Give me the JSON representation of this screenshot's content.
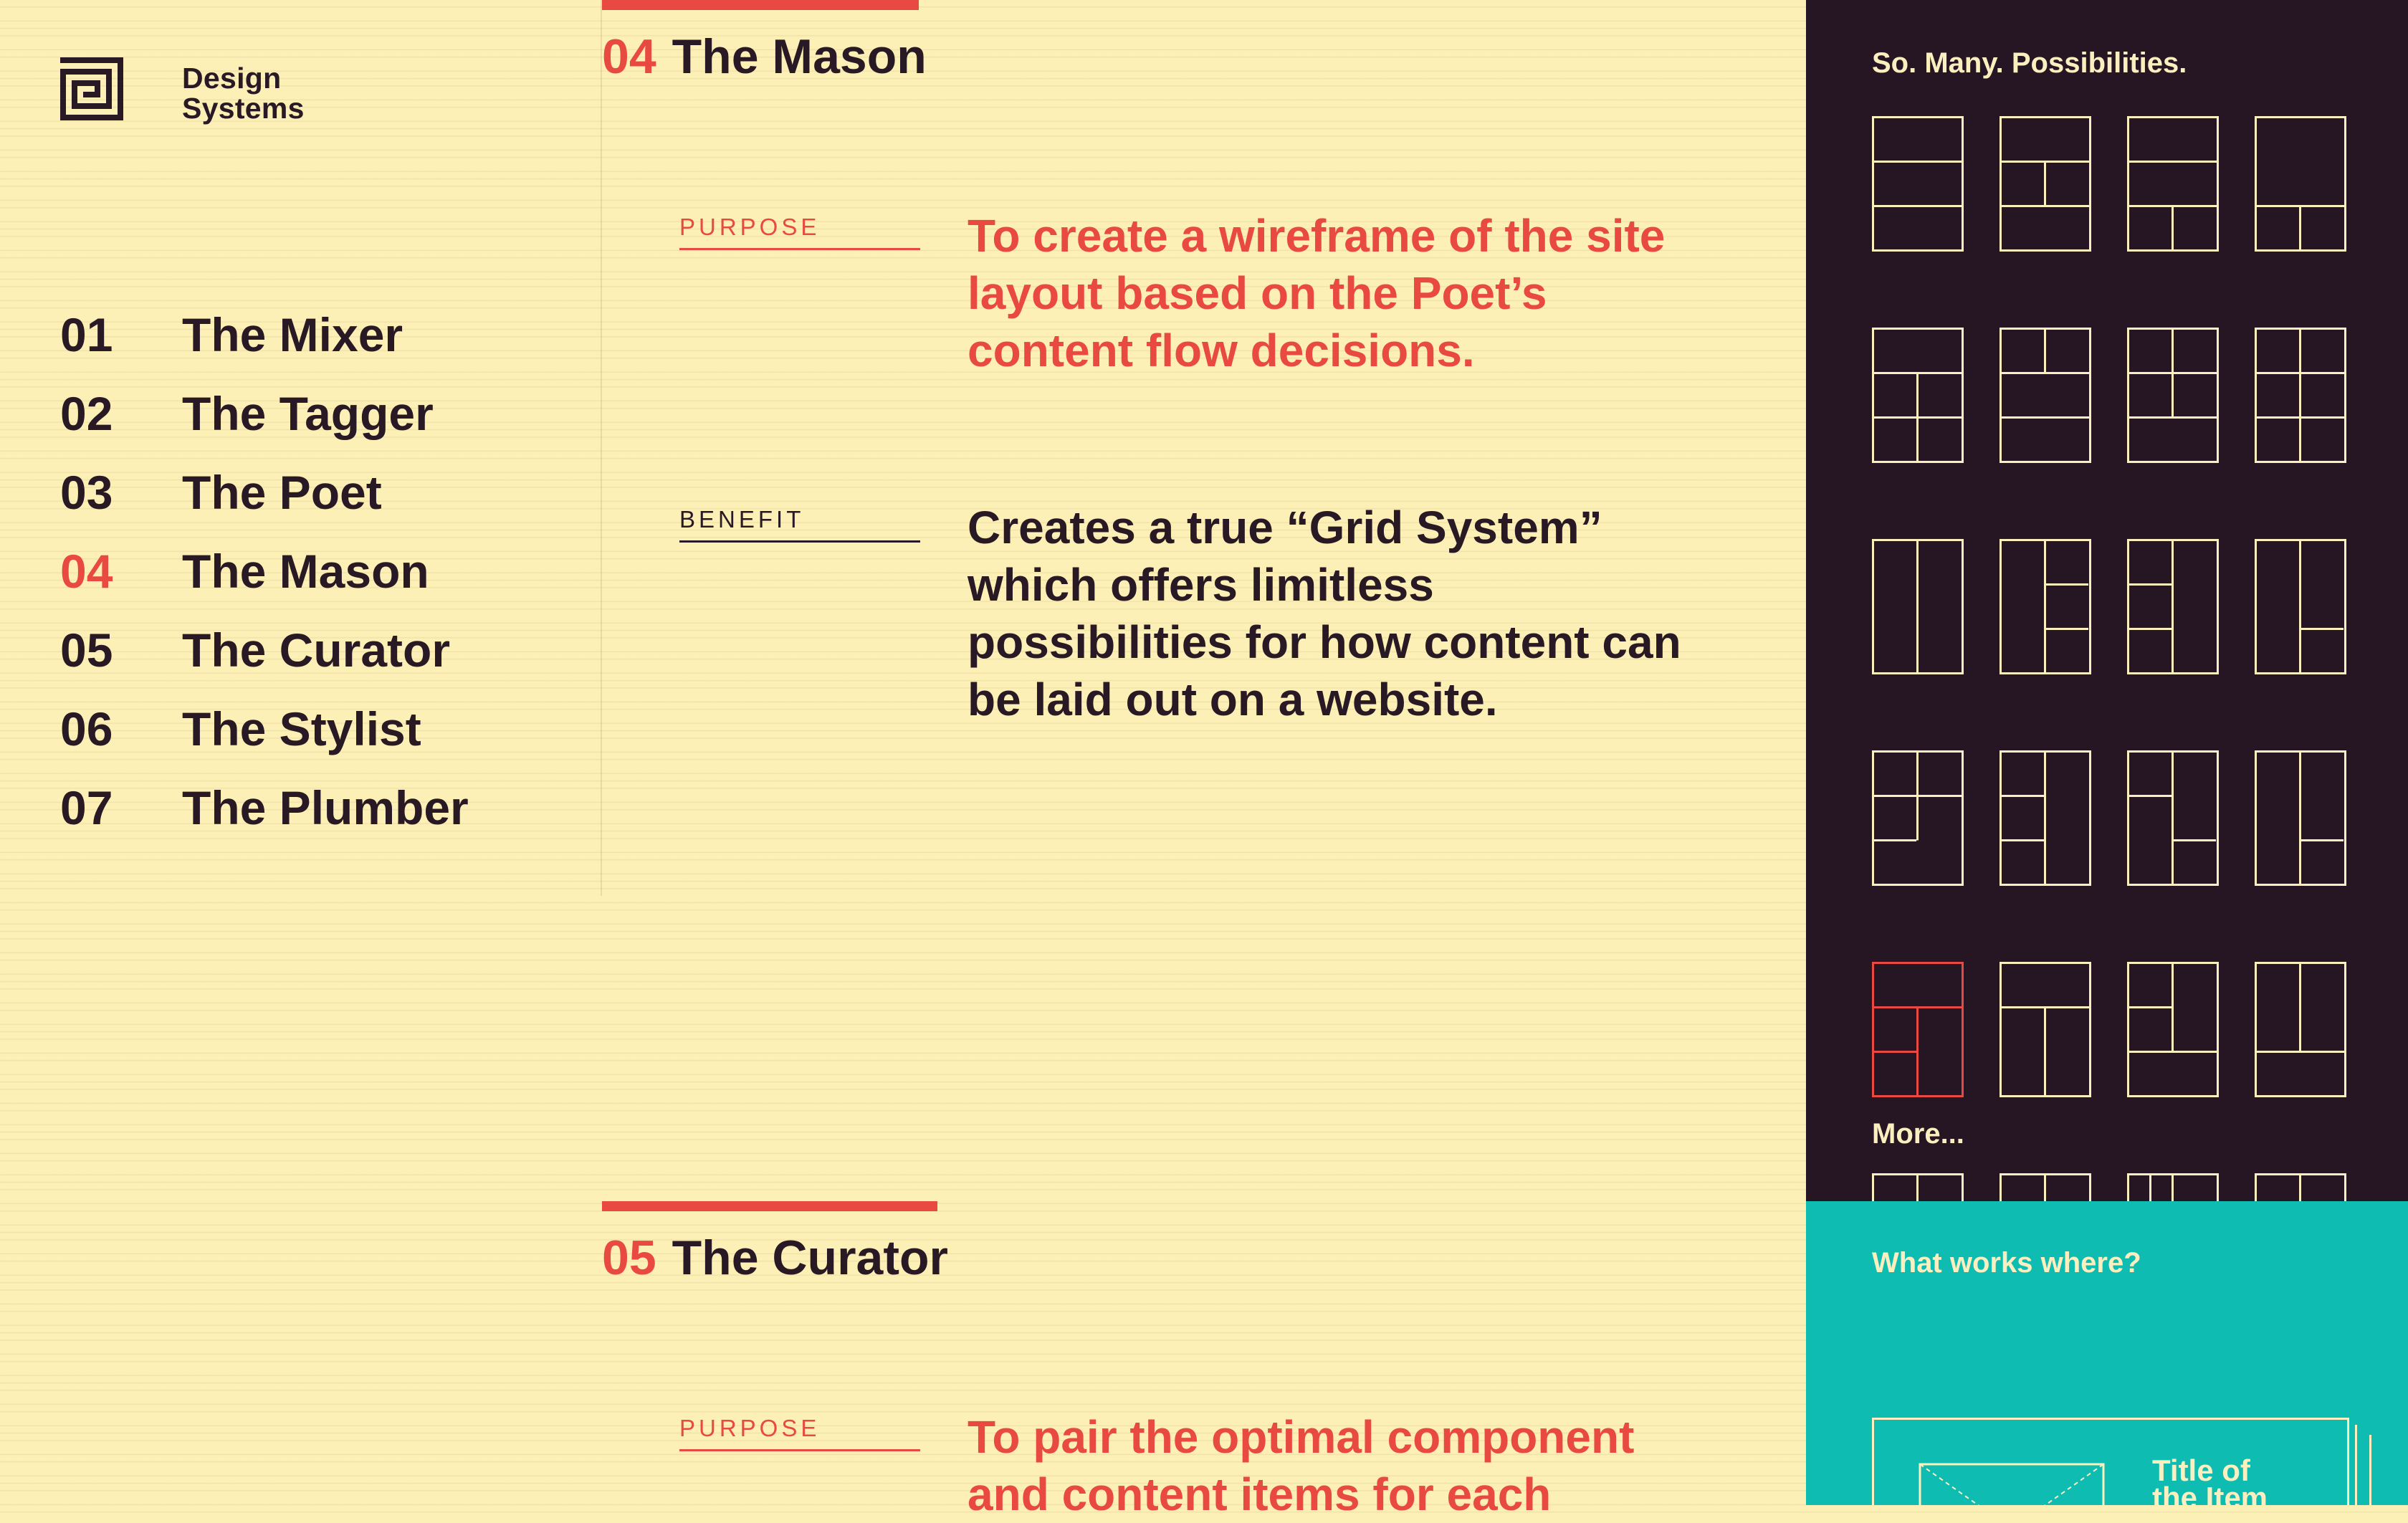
{
  "colors": {
    "background": "#fdf0b6",
    "accent": "#e84a43",
    "text": "#281925",
    "panel_dark": "#261624",
    "panel_teal": "#0fbcb1",
    "panel_text": "#fbefc0"
  },
  "brand": {
    "logo_icon": "square-spiral-logo-icon",
    "line1": "Design",
    "line2": "Systems"
  },
  "nav": {
    "items": [
      {
        "num": "01",
        "label": "The Mixer",
        "active": false
      },
      {
        "num": "02",
        "label": "The Tagger",
        "active": false
      },
      {
        "num": "03",
        "label": "The Poet",
        "active": false
      },
      {
        "num": "04",
        "label": "The Mason",
        "active": true
      },
      {
        "num": "05",
        "label": "The Curator",
        "active": false
      },
      {
        "num": "06",
        "label": "The Stylist",
        "active": false
      },
      {
        "num": "07",
        "label": "The Plumber",
        "active": false
      }
    ]
  },
  "sections": [
    {
      "num": "04",
      "title": "The Mason",
      "purpose_label": "PURPOSE",
      "purpose_text": "To create a wireframe of the site layout based on the Poet’s content flow decisions.",
      "benefit_label": "BENEFIT",
      "benefit_text": "Creates a true “Grid System” which offers limitless possibilities for how content can be laid out on a website."
    },
    {
      "num": "05",
      "title": "The Curator",
      "purpose_label": "PURPOSE",
      "purpose_text": "To pair the optimal component and content items for each"
    }
  ],
  "possibilities": {
    "heading": "So. Many. Possibilities.",
    "more_label": "More...",
    "tile_icon": "grid-layout-icon",
    "highlighted_tile": 16
  },
  "what_works": {
    "heading": "What works where?",
    "card_title": "Title of the Item",
    "card_image_icon": "image-placeholder-icon"
  }
}
